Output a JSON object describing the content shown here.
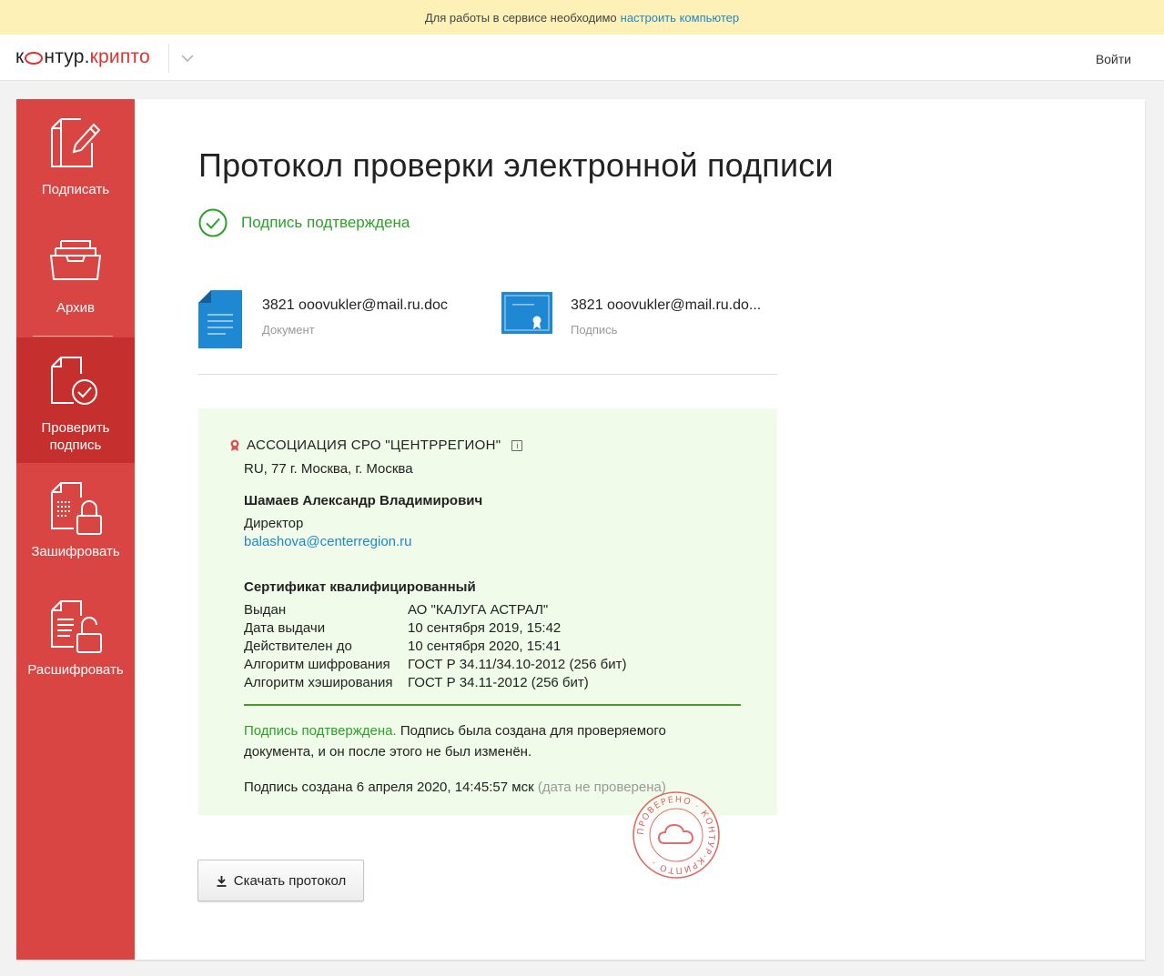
{
  "banner": {
    "text": "Для работы в сервисе необходимо",
    "link": "настроить компьютер"
  },
  "header": {
    "logo_left": "к",
    "logo_mid": "нтур.",
    "logo_right": "крипто",
    "login": "Войти"
  },
  "sidebar": {
    "items": [
      {
        "label": "Подписать",
        "icon": "sign-document-icon"
      },
      {
        "label": "Архив",
        "icon": "archive-tray-icon"
      },
      {
        "label_line1": "Проверить",
        "label_line2": "подпись",
        "icon": "verify-document-icon",
        "active": true
      },
      {
        "label": "Зашифровать",
        "icon": "encrypt-lock-icon"
      },
      {
        "label": "Расшифровать",
        "icon": "decrypt-unlock-icon"
      }
    ]
  },
  "page": {
    "title": "Протокол проверки электронной подписи",
    "status": "Подпись подтверждена"
  },
  "files": [
    {
      "name": "3821 ooovukler@mail.ru.doc",
      "type": "Документ"
    },
    {
      "name": "3821 ooovukler@mail.ru.do...",
      "type": "Подпись"
    }
  ],
  "certificate": {
    "org": "АССОЦИАЦИЯ СРО \"ЦЕНТРРЕГИОН\"",
    "info_icon": "i",
    "location": "RU, 77 г. Москва, г. Москва",
    "person": "Шамаев Александр Владимирович",
    "position": "Директор",
    "email": "balashova@centerregion.ru",
    "cert_title": "Сертификат квалифицированный",
    "details": [
      {
        "key": "Выдан",
        "value": "АО \"КАЛУГА АСТРАЛ\""
      },
      {
        "key": "Дата выдачи",
        "value": "10 сентября 2019, 15:42"
      },
      {
        "key": "Действителен до",
        "value": "10 сентября 2020, 15:41"
      },
      {
        "key": "Алгоритм шифрования",
        "value": "ГОСТ Р 34.11/34.10-2012 (256 бит)"
      },
      {
        "key": "Алгоритм хэширования",
        "value": "ГОСТ Р 34.11-2012 (256 бит)"
      }
    ],
    "verdict_ok": "Подпись подтверждена.",
    "verdict_text": " Подпись была создана для проверяемого документа, и он после этого не был изменён.",
    "created": "Подпись создана 6 апреля 2020, 14:45:57 мск",
    "created_note": "(дата не проверена)"
  },
  "stamp": {
    "text": "ПРОВЕРЕНО · КОНТУР·КРИПТО ·"
  },
  "download_label": "Скачать протокол",
  "colors": {
    "brand_red": "#d94543",
    "active_red": "#c52f2d",
    "success_green": "#2ea02a",
    "link_blue": "#1f87c7",
    "file_blue": "#1e88d2",
    "banner_yellow": "#fdf1b8"
  }
}
